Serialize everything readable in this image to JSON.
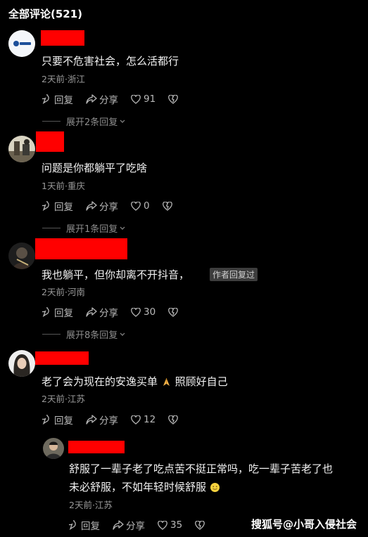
{
  "header": {
    "title": "全部评论(521)"
  },
  "comments": [
    {
      "text": "只要不危害社会，怎么活都行",
      "meta": "2天前·浙江",
      "reply_label": "回复",
      "share_label": "分享",
      "likes": "91",
      "expand": "展开2条回复"
    },
    {
      "text": "问题是你都躺平了吃啥",
      "meta": "1天前·重庆",
      "reply_label": "回复",
      "share_label": "分享",
      "likes": "0",
      "expand": "展开1条回复"
    },
    {
      "text": "我也躺平，但你却离不开抖音，",
      "badge": "作者回复过",
      "meta": "2天前·河南",
      "reply_label": "回复",
      "share_label": "分享",
      "likes": "30",
      "expand": "展开8条回复"
    },
    {
      "text_before": "老了会为现在的安逸买单",
      "text_after": " 照顾好自己",
      "meta": "2天前·江苏",
      "reply_label": "回复",
      "share_label": "分享",
      "likes": "12"
    }
  ],
  "reply": {
    "line1": "舒服了一辈子老了吃点苦不挺正常吗，吃一辈子苦老了也",
    "line2": "未必舒服，不如年轻时候舒服",
    "meta": "2天前·江苏",
    "reply_label": "回复",
    "share_label": "分享",
    "likes": "35"
  },
  "watermark": "搜狐号@小哥入侵社会",
  "colors": {
    "background": "#000000",
    "redact": "#ff0000",
    "meta": "#9a9a9a"
  }
}
